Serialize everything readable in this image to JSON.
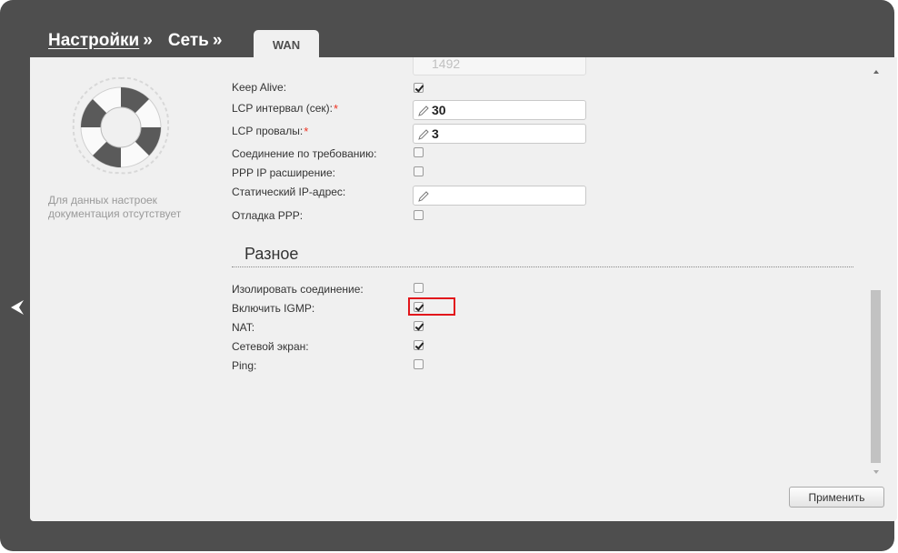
{
  "breadcrumbs": {
    "settings": "Настройки",
    "network": "Сеть",
    "separator": "»",
    "active_tab": "WAN"
  },
  "help": {
    "text": "Для данных настроек документация отсутствует",
    "icon": "lifebuoy-icon"
  },
  "ppp": {
    "mtu_value": "1492",
    "keep_alive_label": "Keep Alive:",
    "keep_alive": true,
    "lcp_interval_label": "LCP интервал (сек):",
    "lcp_interval_value": "30",
    "lcp_failures_label": "LCP провалы:",
    "lcp_failures_value": "3",
    "on_demand_label": "Соединение по требованию:",
    "on_demand": false,
    "ip_extension_label": "PPP IP расширение:",
    "ip_extension": false,
    "static_ip_label": "Статический IP-адрес:",
    "static_ip_value": "",
    "debug_label": "Отладка PPP:",
    "debug": false,
    "required_mark": "*"
  },
  "misc": {
    "title": "Разное",
    "isolate_label": "Изолировать соединение:",
    "isolate": false,
    "igmp_label": "Включить IGMP:",
    "igmp": true,
    "nat_label": "NAT:",
    "nat": true,
    "firewall_label": "Сетевой экран:",
    "firewall": true,
    "ping_label": "Ping:",
    "ping": false
  },
  "apply_button": "Применить",
  "colors": {
    "frame": "#4e4e4e",
    "panel": "#f0f0f0",
    "required": "#e33322",
    "highlight": "#e2161b"
  }
}
